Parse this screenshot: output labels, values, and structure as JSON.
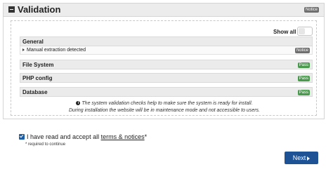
{
  "validation": {
    "title": "Validation",
    "badge": "Notice",
    "show_all_label": "Show all",
    "sections": [
      {
        "title": "General",
        "details": [
          {
            "text": "Manual extraction detected",
            "badge": "Notice"
          }
        ]
      },
      {
        "title": "File System",
        "badge": "Pass"
      },
      {
        "title": "PHP config",
        "badge": "Pass"
      },
      {
        "title": "Database",
        "badge": "Pass"
      }
    ],
    "info_line1": "The system validation checks help to make sure the system is ready for install.",
    "info_line2": "During installation the website will be in maintenance mode and not accessible to users."
  },
  "terms": {
    "checked": true,
    "text_before": "I have read and accept all ",
    "link_text": "terms & notices",
    "text_after": "*",
    "required_note": "* required to continue"
  },
  "next_button": {
    "label": "Next"
  },
  "colors": {
    "accent": "#1d5394",
    "pass": "#4a9a4e",
    "notice": "#6f6f6f"
  }
}
